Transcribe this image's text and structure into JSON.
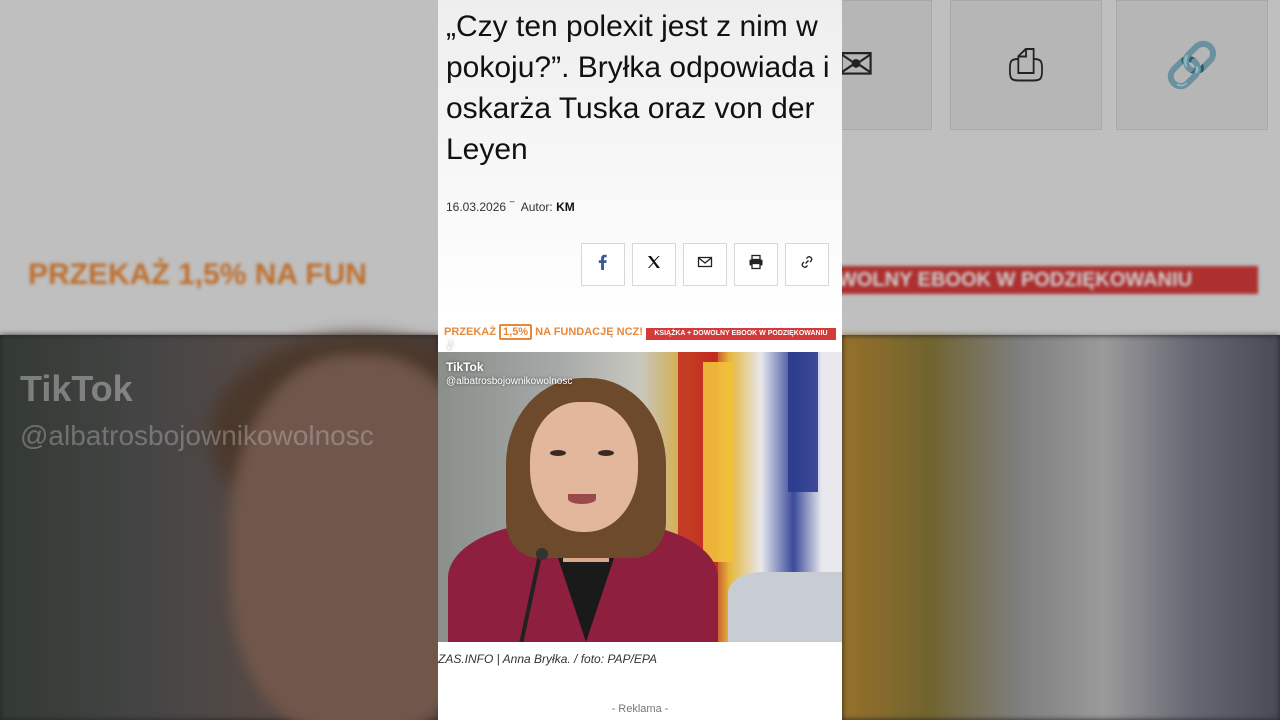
{
  "article": {
    "headline": "„Czy ten polexit jest z nim w pokoju?”. Bryłka odpowiada i oskarża Tuska oraz von der Leyen",
    "date": "16.03.2026",
    "author_prefix": "Autor:",
    "author": "KM"
  },
  "share": {
    "buttons": [
      {
        "name": "facebook",
        "icon": "facebook-icon"
      },
      {
        "name": "x",
        "icon": "x-icon"
      },
      {
        "name": "email",
        "icon": "envelope-icon"
      },
      {
        "name": "print",
        "icon": "printer-icon"
      },
      {
        "name": "link",
        "icon": "link-icon"
      }
    ]
  },
  "ad_banner": {
    "left_text_pre": "PRZEKAŻ",
    "left_percent": "1,5%",
    "left_text_post": "NA FUNDACJĘ NCZ!",
    "right_text": "KSIĄŻKA + DOWOLNY EBOOK W PODZIĘKOWANIU"
  },
  "background": {
    "banner_left": "PRZEKAŻ 1,5% NA FUN",
    "banner_right": "WOLNY EBOOK W PODZIĘKOWANIU",
    "tiktok": "TikTok",
    "handle": "@albatrosbojownikowolnosc"
  },
  "tiktok": {
    "logo": "♪",
    "name": "TikTok",
    "handle": "@albatrosbojownikowolnosc"
  },
  "photo": {
    "caption": "ZAS.INFO | Anna Bryłka. / foto: PAP/EPA"
  },
  "footer": {
    "reklama": "- Reklama -"
  },
  "colors": {
    "accent_orange": "#e8883a",
    "accent_red": "#d43a3a",
    "jacket": "#8e1f3e"
  }
}
